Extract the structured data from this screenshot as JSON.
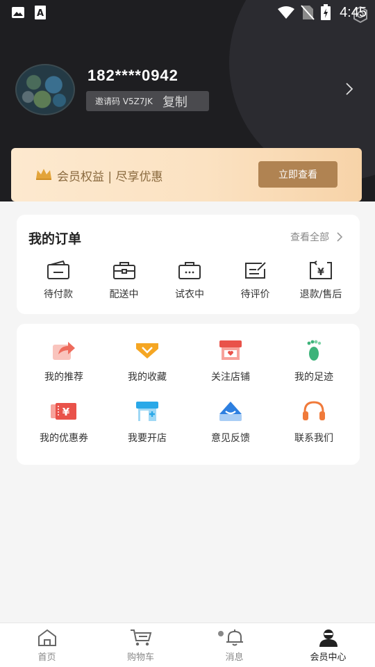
{
  "status_bar": {
    "time": "4:45",
    "left_icons": [
      "image-icon",
      "text-a-icon"
    ],
    "right_icons": [
      "wifi-icon",
      "no-sim-icon",
      "battery-charging-icon"
    ]
  },
  "profile": {
    "phone": "182****0942",
    "invite_code": "邀请码 V5Z7JK",
    "copy_label": "复制"
  },
  "vip_banner": {
    "text": "会员权益 | 尽享优惠",
    "button_label": "立即查看",
    "accent_color": "#b08352"
  },
  "orders": {
    "title": "我的订单",
    "view_all": "查看全部",
    "items": [
      {
        "label": "待付款",
        "icon": "wallet-icon"
      },
      {
        "label": "配送中",
        "icon": "delivery-box-icon"
      },
      {
        "label": "试衣中",
        "icon": "fitting-box-icon"
      },
      {
        "label": "待评价",
        "icon": "review-icon"
      },
      {
        "label": "退款/售后",
        "icon": "refund-icon"
      }
    ]
  },
  "services": {
    "items": [
      {
        "label": "我的推荐",
        "icon": "share-icon",
        "color": "#ee6b5c"
      },
      {
        "label": "我的收藏",
        "icon": "favorite-icon",
        "color": "#f5a623"
      },
      {
        "label": "关注店铺",
        "icon": "shop-icon",
        "color": "#e9524a"
      },
      {
        "label": "我的足迹",
        "icon": "footprint-icon",
        "color": "#3db37a"
      },
      {
        "label": "我的优惠券",
        "icon": "coupon-icon",
        "color": "#e9524a"
      },
      {
        "label": "我要开店",
        "icon": "open-shop-icon",
        "color": "#29a8e8"
      },
      {
        "label": "意见反馈",
        "icon": "feedback-icon",
        "color": "#2d7fe0"
      },
      {
        "label": "联系我们",
        "icon": "headset-icon",
        "color": "#f07a3a"
      }
    ]
  },
  "tab_bar": {
    "items": [
      {
        "label": "首页",
        "icon": "home-icon",
        "active": false
      },
      {
        "label": "购物车",
        "icon": "cart-icon",
        "active": false
      },
      {
        "label": "消息",
        "icon": "bell-icon",
        "active": false,
        "badge": true
      },
      {
        "label": "会员中心",
        "icon": "user-icon",
        "active": true
      }
    ]
  }
}
